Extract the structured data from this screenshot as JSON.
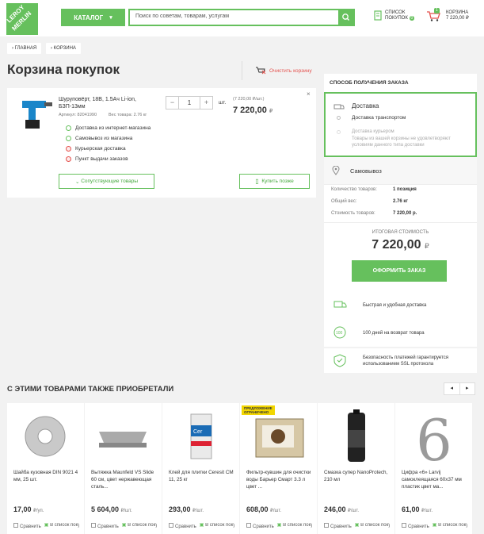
{
  "header": {
    "logo_top": "LEROY",
    "logo_bottom": "MERLIN",
    "catalog": "КАТАЛОГ",
    "search_placeholder": "Поиск по советам, товарам, услугам",
    "list_line1": "СПИСОК",
    "list_line2": "ПОКУПОК",
    "list_count": "0",
    "cart_label": "КОРЗИНА",
    "cart_total": "7 220,00 ₽",
    "cart_count": "1"
  },
  "breadcrumb": [
    "ГЛАВНАЯ",
    "КОРЗИНА"
  ],
  "page": {
    "title": "Корзина покупок",
    "clear": "Очистить корзину"
  },
  "item": {
    "name": "Шуруповёрт, 18В, 1.5Ач Li-ion, БЗП-13мм",
    "article": "Артикул: 82041990",
    "weight": "Вес товара: 2.76 кг",
    "qty": "1",
    "unit": "шт.",
    "unit_price": "(7 220,00 ₽/шт.)",
    "total": "7 220,00",
    "currency": "₽",
    "remove": "×",
    "availability": [
      {
        "label": "Доставка из интернет-магазина",
        "color": "#66c05d"
      },
      {
        "label": "Самовывоз из магазина",
        "color": "#66c05d"
      },
      {
        "label": "Курьерская доставка",
        "color": "#e4514d"
      },
      {
        "label": "Пункт выдачи заказов",
        "color": "#e4514d"
      }
    ],
    "related_btn": "Сопутствующие товары",
    "buy_later_btn": "Купить позже"
  },
  "sidebar": {
    "heading": "СПОСОБ ПОЛУЧЕНИЯ ЗАКАЗА",
    "delivery_title": "Доставка",
    "delivery_option": "Доставка транспортом",
    "courier_title": "Доставка курьером",
    "courier_note": "Товары из вашей корзины не удовлетворяют условиям данного типа доставки",
    "pickup": "Самовывоз",
    "rows": [
      {
        "k": "Количество товаров:",
        "v": "1 позиция"
      },
      {
        "k": "Общий вес:",
        "v": "2.76 кг"
      },
      {
        "k": "Стоимость товаров:",
        "v": "7 220,00 р."
      }
    ],
    "total_label": "ИТОГОВАЯ СТОИМОСТЬ",
    "total": "7 220,00",
    "currency": "₽",
    "order_btn": "ОФОРМИТЬ ЗАКАЗ",
    "benefits": [
      {
        "icon": "truck-icon",
        "text": "Быстрая и удобная доставка"
      },
      {
        "icon": "return-100-icon",
        "text": "100 дней на возврат товара"
      },
      {
        "icon": "shield-icon",
        "text": "Безопасность платежей гарантируется использованием SSL протокола"
      }
    ]
  },
  "recs": {
    "heading": "С ЭТИМИ ТОВАРАМИ ТАКЖЕ ПРИОБРЕТАЛИ",
    "prev": "◂",
    "next": "▸",
    "compare": "Сравнить",
    "to_list": "В список покупок",
    "badge": "ПРЕДЛОЖЕНИЕ",
    "badge2": "ОГРАНИЧЕНО",
    "items": [
      {
        "name": "Шайба кузовная DIN 9021 4 мм, 25 шт.",
        "price": "17,00",
        "unit": "₽/уп."
      },
      {
        "name": "Вытяжка Maunfeld VS Slide 60 см, цвет нержавеющая сталь...",
        "price": "5 604,00",
        "unit": "₽/шт."
      },
      {
        "name": "Клей для плитки Ceresit CM 11, 25 кг",
        "price": "293,00",
        "unit": "₽/шт."
      },
      {
        "name": "Фильтр-кувшин для очистки воды Барьер Смарт 3.3 л цвет ...",
        "price": "608,00",
        "unit": "₽/шт."
      },
      {
        "name": "Смазка супер NanoProtech, 210 мл",
        "price": "246,00",
        "unit": "₽/шт."
      },
      {
        "name": "Цифра «6» Larvij самоклеящаяся 60х37 мм пластик цвет ма...",
        "price": "61,00",
        "unit": "₽/шт."
      }
    ]
  }
}
